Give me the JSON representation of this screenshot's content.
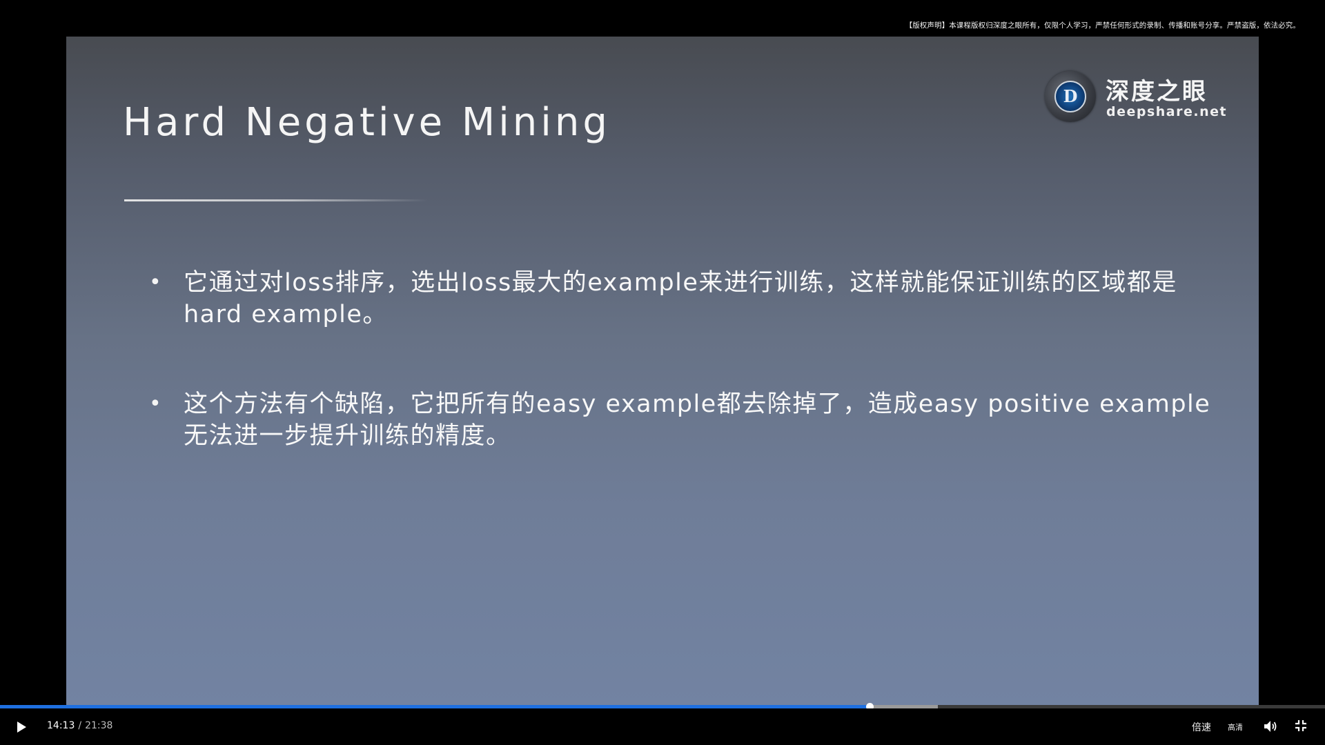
{
  "copyright_notice": "【版权声明】本课程版权归深度之眼所有，仅限个人学习，严禁任何形式的录制、传播和账号分享。严禁盗版，依法必究。",
  "slide": {
    "title": "Hard Negative Mining",
    "logo_cn": "深度之眼",
    "logo_en": "deepshare.net",
    "logo_letter": "D",
    "bullets": [
      {
        "marker": "•",
        "text": "它通过对loss排序，选出loss最大的example来进行训练，这样就能保证训练的区域都是hard example。"
      },
      {
        "marker": "•",
        "text": "这个方法有个缺陷，它把所有的easy example都去除掉了，造成easy positive example无法进一步提升训练的精度。"
      }
    ]
  },
  "player": {
    "current_time": "14:13",
    "separator": "/",
    "total_time": "21:38",
    "played_fraction": 0.6564,
    "buffered_fraction": 0.708,
    "speed_label": "倍速",
    "quality_label": "高清",
    "colors": {
      "played": "#1e6fe0",
      "buffered": "#9a9a9a",
      "track": "#3a3a3a"
    },
    "icons": {
      "play": "play-icon",
      "volume": "volume-icon",
      "fullscreen_exit": "exit-fullscreen-icon"
    }
  }
}
